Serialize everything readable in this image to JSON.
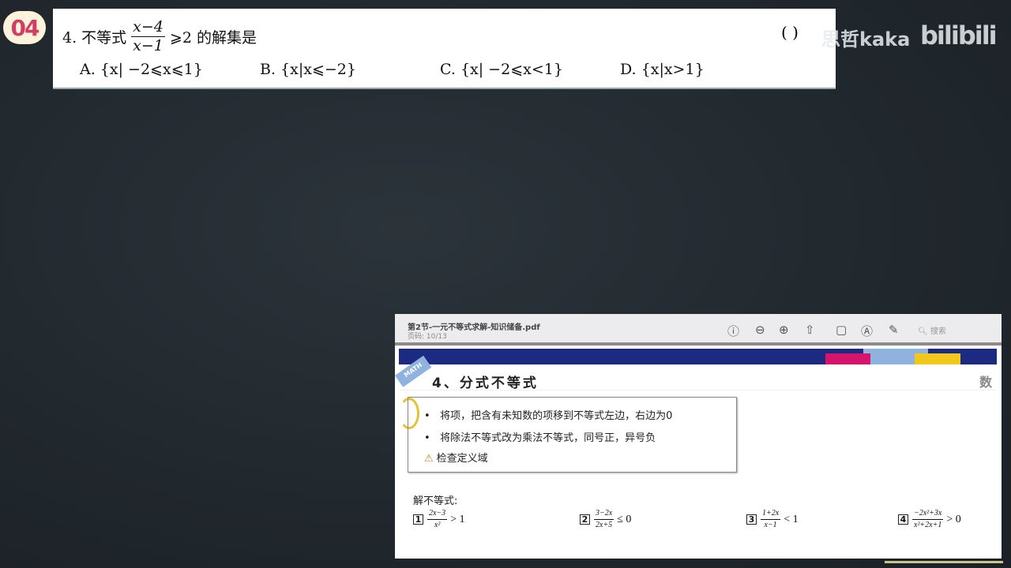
{
  "badge": "04",
  "question": {
    "prefix": "4. 不等式",
    "num": "x−4",
    "den": "x−1",
    "suffix": "⩾2 的解集是",
    "paren": "(    )",
    "options": [
      "A. {x| −2⩽x⩽1}",
      "B. {x|x⩽−2}",
      "C. {x| −2⩽x<1}",
      "D. {x|x>1}"
    ]
  },
  "watermark": {
    "author": "思哲kaka",
    "site": "bilibili"
  },
  "pdf": {
    "filename": "第2节-一元不等式求解-知识储备.pdf",
    "page": "页码: 10/13",
    "search": "搜索",
    "tag": "MATH",
    "heading": "4、分式不等式",
    "side": "数",
    "tips": [
      "将项，把含有未知数的项移到不等式左边，右边为0",
      "将除法不等式改为乘法不等式，同号正，异号负",
      "检查定义域"
    ],
    "solve_label": "解不等式:",
    "exercises": [
      {
        "n": "1",
        "num": "2x−3",
        "den": "x²",
        "rel": "> 1"
      },
      {
        "n": "2",
        "num": "3−2x",
        "den": "2x+5",
        "rel": "≤ 0"
      },
      {
        "n": "3",
        "num": "1+2x",
        "den": "x−1",
        "rel": "< 1"
      },
      {
        "n": "4",
        "num": "−2x²+3x",
        "den": "x²+2x+1",
        "rel": "> 0"
      }
    ]
  },
  "colors": {
    "band": "#1d2a82",
    "pink": "#d6146b",
    "lightblue": "#8fb2de",
    "yellow": "#f2c81c",
    "badge": "#d23d63"
  }
}
